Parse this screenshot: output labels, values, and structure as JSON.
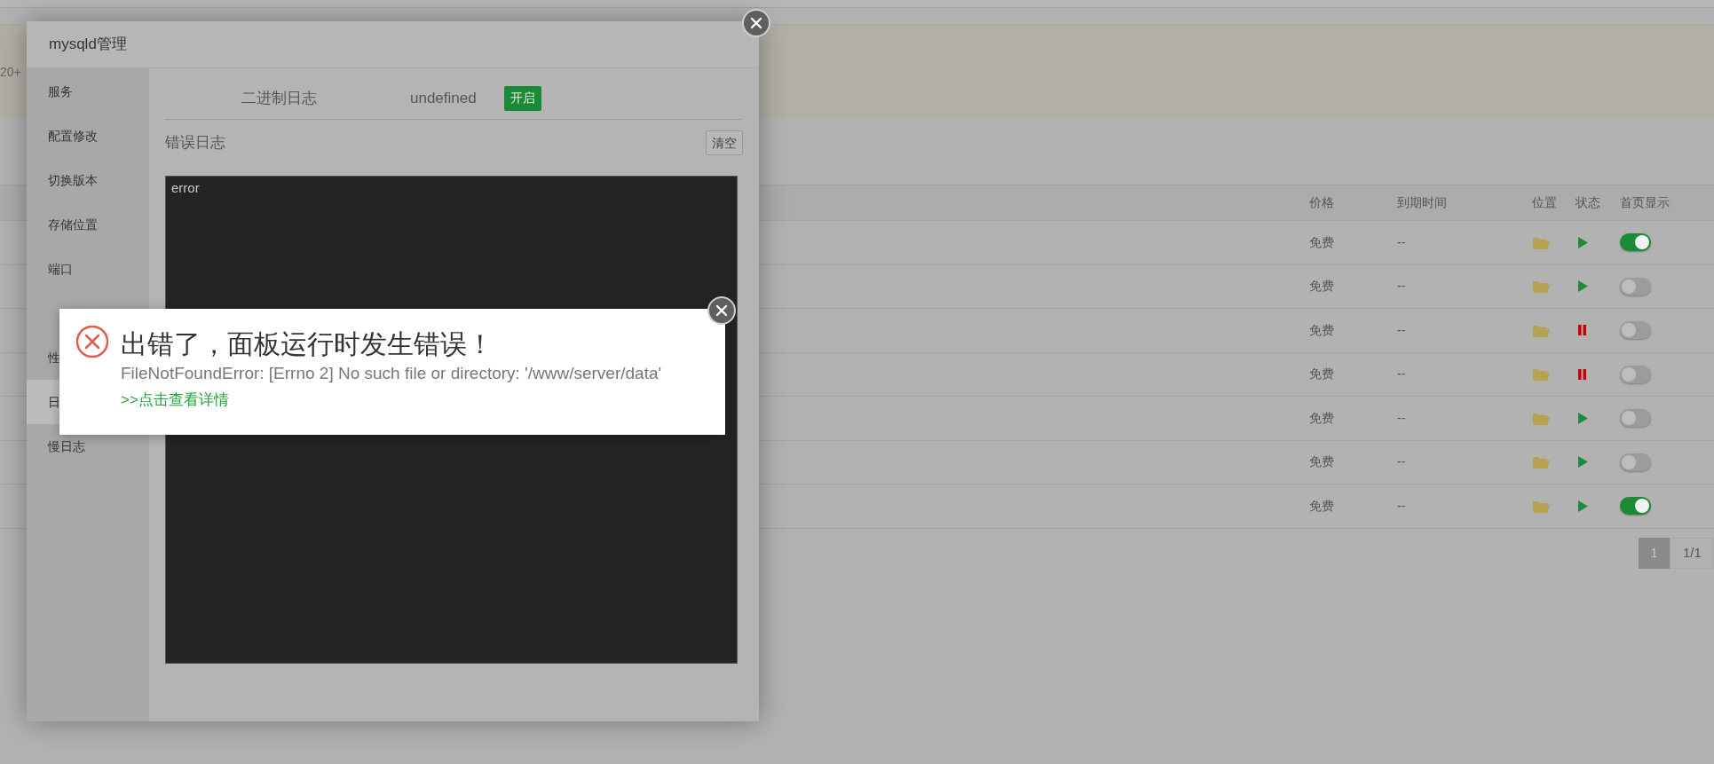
{
  "page": {
    "fragment": "20+",
    "table": {
      "columns": [
        "价格",
        "到期时间",
        "位置",
        "状态",
        "首页显示"
      ],
      "rows": [
        {
          "price": "免费",
          "expiry": "--",
          "running": true,
          "homepage": true
        },
        {
          "price": "免费",
          "expiry": "--",
          "running": true,
          "homepage": false
        },
        {
          "price": "免费",
          "expiry": "--",
          "running": false,
          "homepage": false
        },
        {
          "price": "免费",
          "expiry": "--",
          "running": false,
          "homepage": false
        },
        {
          "price": "免费",
          "expiry": "--",
          "running": true,
          "homepage": false
        },
        {
          "price": "免费",
          "expiry": "--",
          "running": true,
          "homepage": false
        },
        {
          "price": "免费",
          "expiry": "--",
          "running": true,
          "homepage": true
        }
      ]
    },
    "pagination": {
      "pages": [
        {
          "label": "1",
          "selected": true
        }
      ],
      "summary": "1/1"
    }
  },
  "modal": {
    "title": "mysqld管理",
    "sidebar": [
      {
        "label": "服务",
        "selected": false
      },
      {
        "label": "配置修改",
        "selected": false
      },
      {
        "label": "切换版本",
        "selected": false
      },
      {
        "label": "存储位置",
        "selected": false
      },
      {
        "label": "端口",
        "selected": false
      },
      {
        "label": "性",
        "selected": false
      },
      {
        "label": "日",
        "selected": true
      },
      {
        "label": "慢日志",
        "selected": false
      }
    ],
    "binlog": {
      "label": "二进制日志",
      "value": "undefined",
      "badge": "开启"
    },
    "error_log": {
      "title": "错误日志",
      "clear_button": "清空",
      "content": "error"
    }
  },
  "error_dialog": {
    "title": "出错了，面板运行时发生错误！",
    "message": "FileNotFoundError: [Errno 2] No such file or directory: '/www/server/data'",
    "link": ">>点击查看详情"
  }
}
